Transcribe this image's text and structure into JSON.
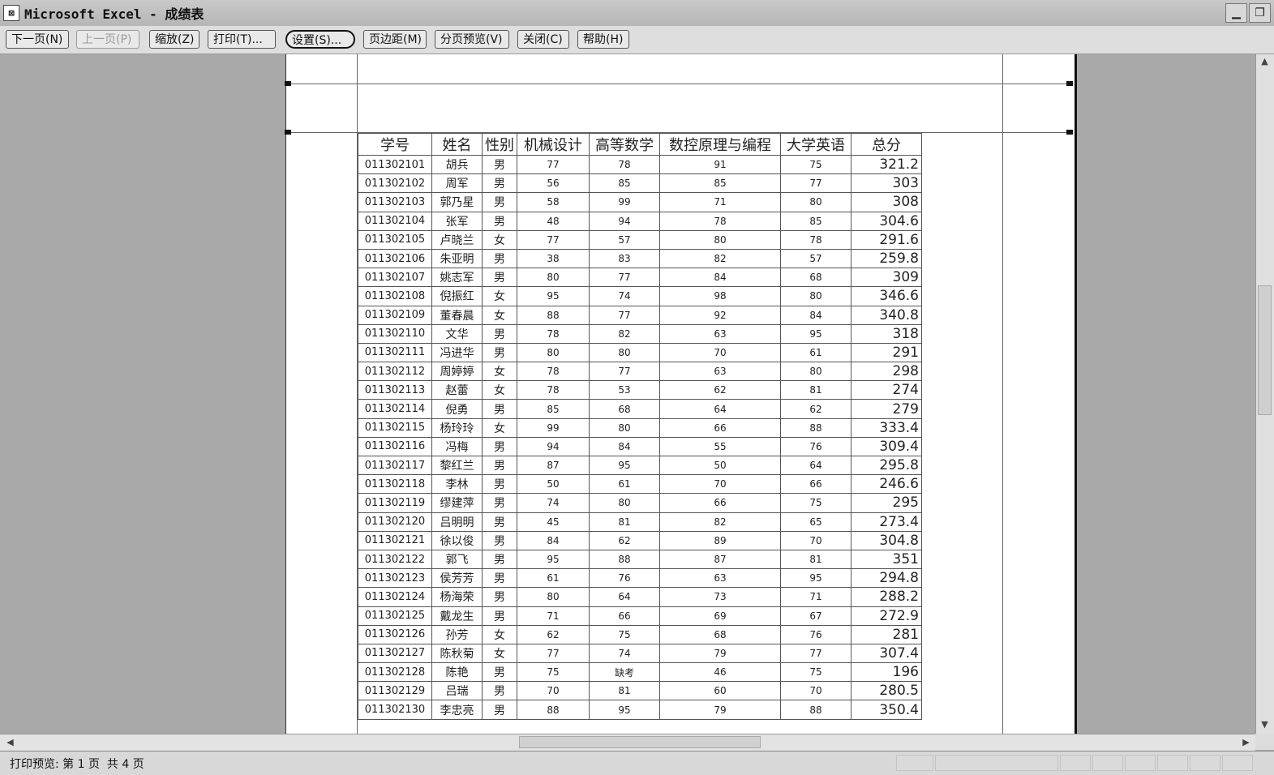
{
  "window": {
    "title": "Microsoft Excel - 成绩表"
  },
  "toolbar": {
    "next": "下一页(N)",
    "prev": "上一页(P)",
    "zoom": "缩放(Z)",
    "print": "打印(T)...",
    "setup": "设置(S)...",
    "margins": "页边距(M)",
    "pagebreak": "分页预览(V)",
    "close": "关闭(C)",
    "help": "帮助(H)"
  },
  "table": {
    "headers": [
      "学号",
      "姓名",
      "性别",
      "机械设计",
      "高等数学",
      "数控原理与编程",
      "大学英语",
      "总分"
    ],
    "rows": [
      [
        "011302101",
        "胡兵",
        "男",
        "77",
        "78",
        "91",
        "75",
        "321.2"
      ],
      [
        "011302102",
        "周军",
        "男",
        "56",
        "85",
        "85",
        "77",
        "303"
      ],
      [
        "011302103",
        "郭乃星",
        "男",
        "58",
        "99",
        "71",
        "80",
        "308"
      ],
      [
        "011302104",
        "张军",
        "男",
        "48",
        "94",
        "78",
        "85",
        "304.6"
      ],
      [
        "011302105",
        "卢晓兰",
        "女",
        "77",
        "57",
        "80",
        "78",
        "291.6"
      ],
      [
        "011302106",
        "朱亚明",
        "男",
        "38",
        "83",
        "82",
        "57",
        "259.8"
      ],
      [
        "011302107",
        "姚志军",
        "男",
        "80",
        "77",
        "84",
        "68",
        "309"
      ],
      [
        "011302108",
        "倪振红",
        "女",
        "95",
        "74",
        "98",
        "80",
        "346.6"
      ],
      [
        "011302109",
        "董春晨",
        "女",
        "88",
        "77",
        "92",
        "84",
        "340.8"
      ],
      [
        "011302110",
        "文华",
        "男",
        "78",
        "82",
        "63",
        "95",
        "318"
      ],
      [
        "011302111",
        "冯进华",
        "男",
        "80",
        "80",
        "70",
        "61",
        "291"
      ],
      [
        "011302112",
        "周婷婷",
        "女",
        "78",
        "77",
        "63",
        "80",
        "298"
      ],
      [
        "011302113",
        "赵蕾",
        "女",
        "78",
        "53",
        "62",
        "81",
        "274"
      ],
      [
        "011302114",
        "倪勇",
        "男",
        "85",
        "68",
        "64",
        "62",
        "279"
      ],
      [
        "011302115",
        "杨玲玲",
        "女",
        "99",
        "80",
        "66",
        "88",
        "333.4"
      ],
      [
        "011302116",
        "冯梅",
        "男",
        "94",
        "84",
        "55",
        "76",
        "309.4"
      ],
      [
        "011302117",
        "黎红兰",
        "男",
        "87",
        "95",
        "50",
        "64",
        "295.8"
      ],
      [
        "011302118",
        "李林",
        "男",
        "50",
        "61",
        "70",
        "66",
        "246.6"
      ],
      [
        "011302119",
        "缪建萍",
        "男",
        "74",
        "80",
        "66",
        "75",
        "295"
      ],
      [
        "011302120",
        "吕明明",
        "男",
        "45",
        "81",
        "82",
        "65",
        "273.4"
      ],
      [
        "011302121",
        "徐以俊",
        "男",
        "84",
        "62",
        "89",
        "70",
        "304.8"
      ],
      [
        "011302122",
        "郭飞",
        "男",
        "95",
        "88",
        "87",
        "81",
        "351"
      ],
      [
        "011302123",
        "侯芳芳",
        "男",
        "61",
        "76",
        "63",
        "95",
        "294.8"
      ],
      [
        "011302124",
        "杨海荣",
        "男",
        "80",
        "64",
        "73",
        "71",
        "288.2"
      ],
      [
        "011302125",
        "戴龙生",
        "男",
        "71",
        "66",
        "69",
        "67",
        "272.9"
      ],
      [
        "011302126",
        "孙芳",
        "女",
        "62",
        "75",
        "68",
        "76",
        "281"
      ],
      [
        "011302127",
        "陈秋菊",
        "女",
        "77",
        "74",
        "79",
        "77",
        "307.4"
      ],
      [
        "011302128",
        "陈艳",
        "男",
        "75",
        "缺考",
        "46",
        "75",
        "196"
      ],
      [
        "011302129",
        "吕瑞",
        "男",
        "70",
        "81",
        "60",
        "70",
        "280.5"
      ],
      [
        "011302130",
        "李忠亮",
        "男",
        "88",
        "95",
        "79",
        "88",
        "350.4"
      ]
    ]
  },
  "status": {
    "text": "打印预览: 第 1 页  共 4 页"
  },
  "icons": {
    "app": "excel-app-icon",
    "minimize": "minimize-icon",
    "restore": "restore-icon",
    "scroll_up": "scroll-up-arrow-icon",
    "scroll_down": "scroll-down-arrow-icon",
    "scroll_left": "scroll-left-arrow-icon",
    "scroll_right": "scroll-right-arrow-icon"
  }
}
